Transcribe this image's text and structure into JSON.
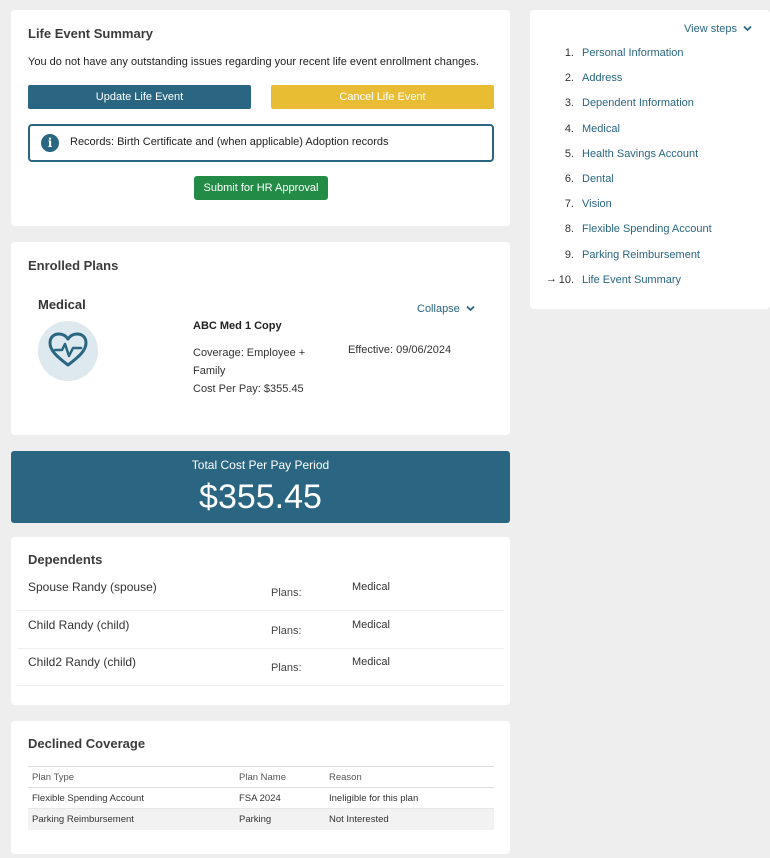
{
  "life_event_summary": {
    "title": "Life Event Summary",
    "message": "You do not have any outstanding issues regarding your recent life event enrollment changes.",
    "update_label": "Update Life Event",
    "cancel_label": "Cancel Life Event",
    "info_text": "Records: Birth Certificate and (when applicable) Adoption records",
    "submit_label": "Submit for HR Approval"
  },
  "enrolled_plans": {
    "title": "Enrolled Plans",
    "plan_type": "Medical",
    "collapse_label": "Collapse",
    "plan_name": "ABC Med 1 Copy",
    "coverage": "Coverage: Employee + Family",
    "effective": "Effective: 09/06/2024",
    "cost": "Cost Per Pay: $355.45",
    "icon": "heart-pulse-icon"
  },
  "total": {
    "label": "Total Cost Per Pay Period",
    "value": "$355.45"
  },
  "dependents": {
    "title": "Dependents",
    "plans_label": "Plans:",
    "rows": [
      {
        "name": "Spouse Randy (spouse)",
        "plans": "Medical"
      },
      {
        "name": "Child Randy (child)",
        "plans": "Medical"
      },
      {
        "name": "Child2 Randy (child)",
        "plans": "Medical"
      }
    ]
  },
  "declined": {
    "title": "Declined Coverage",
    "headers": [
      "Plan Type",
      "Plan Name",
      "Reason"
    ],
    "rows": [
      [
        "Flexible Spending Account",
        "FSA 2024",
        "Ineligible for this plan"
      ],
      [
        "Parking Reimbursement",
        "Parking",
        "Not Interested"
      ]
    ]
  },
  "steps": {
    "view_label": "View steps",
    "items": [
      {
        "num": "1.",
        "label": "Personal Information"
      },
      {
        "num": "2.",
        "label": "Address"
      },
      {
        "num": "3.",
        "label": "Dependent Information"
      },
      {
        "num": "4.",
        "label": "Medical"
      },
      {
        "num": "5.",
        "label": "Health Savings Account"
      },
      {
        "num": "6.",
        "label": "Dental"
      },
      {
        "num": "7.",
        "label": "Vision"
      },
      {
        "num": "8.",
        "label": "Flexible Spending Account"
      },
      {
        "num": "9.",
        "label": "Parking Reimbursement"
      },
      {
        "num": "10.",
        "label": "Life Event Summary"
      }
    ],
    "current_index": 9
  },
  "colors": {
    "primary": "#2a6681",
    "warning": "#e8bd34",
    "success": "#228b45"
  }
}
